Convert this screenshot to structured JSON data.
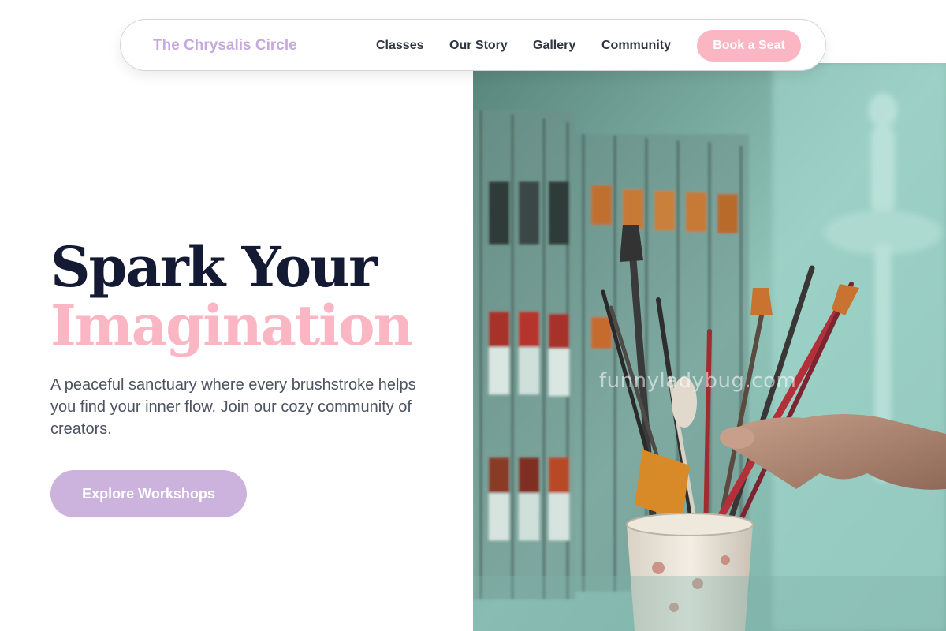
{
  "navbar": {
    "brand": "The Chrysalis Circle",
    "links": [
      "Classes",
      "Our Story",
      "Gallery",
      "Community"
    ],
    "cta_label": "Book a Seat"
  },
  "hero": {
    "headline_line1": "Spark Your",
    "headline_line2": "Imagination",
    "description": "A peaceful sanctuary where every brushstroke helps you find your inner flow. Join our cozy community of creators.",
    "cta_label": "Explore Workshops",
    "image_watermark": "funnyladybug.com"
  },
  "colors": {
    "brand_lavender": "#c6a9dd",
    "accent_pink": "#fbb6c3",
    "cta_lavender": "#cbb3dd",
    "headline_navy": "#141a33",
    "body_text": "#4c5260"
  }
}
